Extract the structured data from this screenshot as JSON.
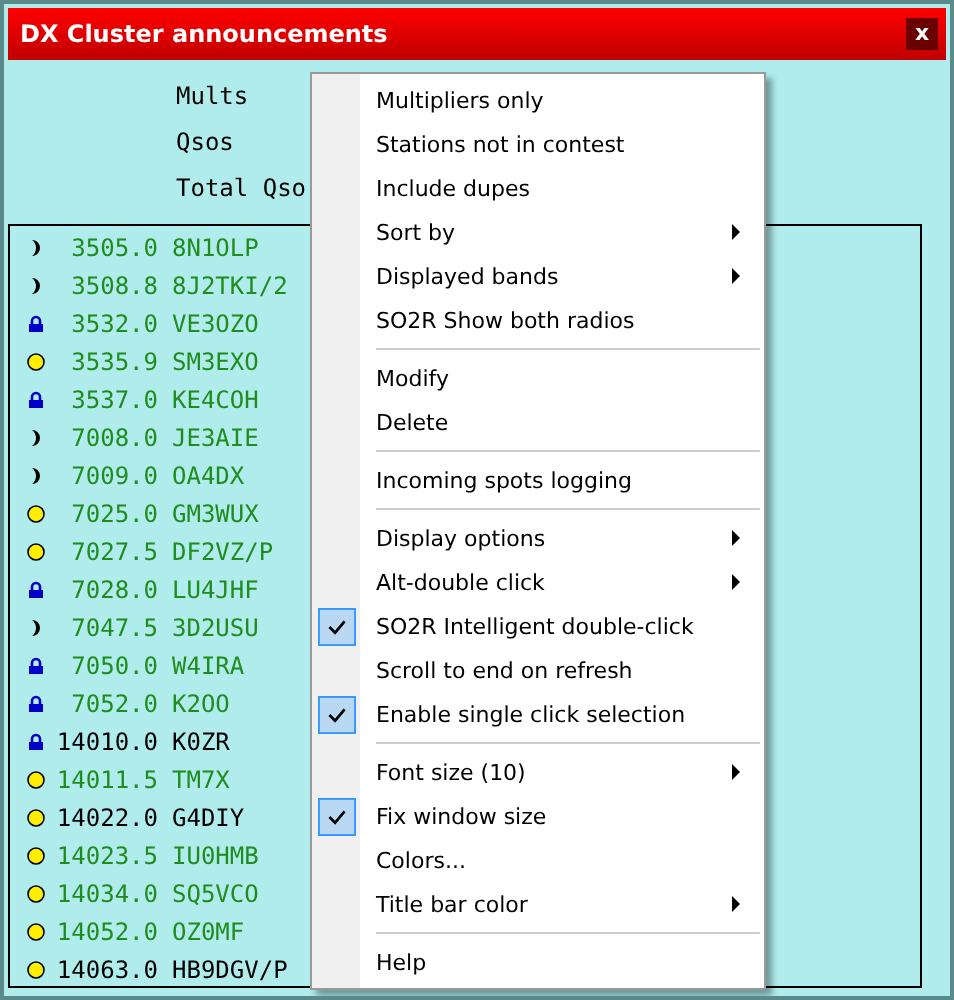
{
  "window": {
    "title": "DX Cluster announcements",
    "close": "x"
  },
  "summary": {
    "labels": [
      "Mults",
      "Qsos",
      "Total Qso"
    ]
  },
  "spots": [
    {
      "kind": "moon",
      "freq": "3505.0",
      "call": "8N1OLP",
      "color": "#1e8c1e"
    },
    {
      "kind": "moon",
      "freq": "3508.8",
      "call": "8J2TKI/2",
      "color": "#1e8c1e"
    },
    {
      "kind": "lock",
      "freq": "3532.0",
      "call": "VE3OZO",
      "color": "#1e8c1e"
    },
    {
      "kind": "circle",
      "freq": "3535.9",
      "call": "SM3EXO",
      "color": "#1e8c1e"
    },
    {
      "kind": "lock",
      "freq": "3537.0",
      "call": "KE4COH",
      "color": "#1e8c1e"
    },
    {
      "kind": "moon",
      "freq": "7008.0",
      "call": "JE3AIE",
      "color": "#1e8c1e"
    },
    {
      "kind": "moon",
      "freq": "7009.0",
      "call": "OA4DX",
      "color": "#1e8c1e"
    },
    {
      "kind": "circle",
      "freq": "7025.0",
      "call": "GM3WUX",
      "color": "#1e8c1e"
    },
    {
      "kind": "circle",
      "freq": "7027.5",
      "call": "DF2VZ/P",
      "color": "#1e8c1e"
    },
    {
      "kind": "lock",
      "freq": "7028.0",
      "call": "LU4JHF",
      "color": "#1e8c1e"
    },
    {
      "kind": "moon",
      "freq": "7047.5",
      "call": "3D2USU",
      "color": "#1e8c1e"
    },
    {
      "kind": "lock",
      "freq": "7050.0",
      "call": "W4IRA",
      "color": "#1e8c1e"
    },
    {
      "kind": "lock",
      "freq": "7052.0",
      "call": "K2OO",
      "color": "#1e8c1e"
    },
    {
      "kind": "lock",
      "freq": "14010.0",
      "call": "K0ZR",
      "color": "#000000"
    },
    {
      "kind": "circle",
      "freq": "14011.5",
      "call": "TM7X",
      "color": "#1e8c1e"
    },
    {
      "kind": "circle",
      "freq": "14022.0",
      "call": "G4DIY",
      "color": "#000000"
    },
    {
      "kind": "circle",
      "freq": "14023.5",
      "call": "IU0HMB",
      "color": "#1e8c1e"
    },
    {
      "kind": "circle",
      "freq": "14034.0",
      "call": "SQ5VCO",
      "color": "#1e8c1e"
    },
    {
      "kind": "circle",
      "freq": "14052.0",
      "call": "OZ0MF",
      "color": "#1e8c1e"
    },
    {
      "kind": "circle",
      "freq": "14063.0",
      "call": "HB9DGV/P",
      "color": "#000000"
    }
  ],
  "context_menu": [
    {
      "kind": "item",
      "label": "Multipliers only",
      "checked": false,
      "submenu": false
    },
    {
      "kind": "item",
      "label": "Stations not in contest",
      "checked": false,
      "submenu": false
    },
    {
      "kind": "item",
      "label": "Include dupes",
      "checked": false,
      "submenu": false
    },
    {
      "kind": "item",
      "label": "Sort by",
      "checked": false,
      "submenu": true
    },
    {
      "kind": "item",
      "label": "Displayed bands",
      "checked": false,
      "submenu": true
    },
    {
      "kind": "item",
      "label": "SO2R Show both radios",
      "checked": false,
      "submenu": false
    },
    {
      "kind": "separator"
    },
    {
      "kind": "item",
      "label": "Modify",
      "checked": false,
      "submenu": false
    },
    {
      "kind": "item",
      "label": "Delete",
      "checked": false,
      "submenu": false
    },
    {
      "kind": "separator"
    },
    {
      "kind": "item",
      "label": "Incoming spots logging",
      "checked": false,
      "submenu": false
    },
    {
      "kind": "separator"
    },
    {
      "kind": "item",
      "label": "Display options",
      "checked": false,
      "submenu": true
    },
    {
      "kind": "item",
      "label": "Alt-double click",
      "checked": false,
      "submenu": true
    },
    {
      "kind": "item",
      "label": "SO2R Intelligent double-click",
      "checked": true,
      "submenu": false
    },
    {
      "kind": "item",
      "label": "Scroll to end on refresh",
      "checked": false,
      "submenu": false
    },
    {
      "kind": "item",
      "label": "Enable single click selection",
      "checked": true,
      "submenu": false
    },
    {
      "kind": "separator"
    },
    {
      "kind": "item",
      "label": "Font size (10)",
      "checked": false,
      "submenu": true
    },
    {
      "kind": "item",
      "label": "Fix window size",
      "checked": true,
      "submenu": false
    },
    {
      "kind": "item",
      "label": "Colors...",
      "checked": false,
      "submenu": false
    },
    {
      "kind": "item",
      "label": "Title bar color",
      "checked": false,
      "submenu": true
    },
    {
      "kind": "separator"
    },
    {
      "kind": "item",
      "label": "Help",
      "checked": false,
      "submenu": false
    }
  ]
}
